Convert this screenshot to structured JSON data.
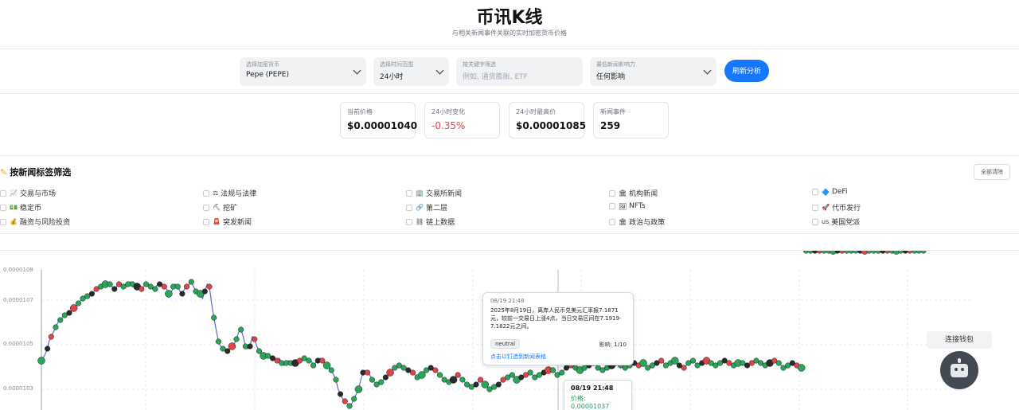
{
  "header": {
    "title": "币讯K线",
    "subtitle": "与相关新闻事件关联的实时加密货币价格"
  },
  "controls": {
    "crypto": {
      "label": "选择加密货币",
      "value": "Pepe (PEPE)"
    },
    "range": {
      "label": "选择时间范围",
      "value": "24小时"
    },
    "keyword": {
      "label": "按关键字筛选",
      "placeholder": "例如, 通货膨胀, ETF"
    },
    "impact": {
      "label": "最低新闻影响力",
      "value": "任何影响"
    },
    "refresh_label": "刷新分析"
  },
  "stats": [
    {
      "label": "当前价格",
      "value": "$0.00001040"
    },
    {
      "label": "24小时变化",
      "value": "-0.35%"
    },
    {
      "label": "24小时最高价",
      "value": "$0.00001085"
    },
    {
      "label": "新闻事件",
      "value": "259"
    }
  ],
  "filters": {
    "title": "按新闻标签筛选",
    "clear_label": "全部清除",
    "tags": [
      {
        "icon": "📈",
        "label": "交易与市场"
      },
      {
        "icon": "⚖",
        "label": "法规与法律"
      },
      {
        "icon": "🏢",
        "label": "交易所新闻"
      },
      {
        "icon": "🏛",
        "label": "机构新闻"
      },
      {
        "icon": "🔷",
        "label": "DeFi"
      },
      {
        "icon": "💵",
        "label": "稳定币"
      },
      {
        "icon": "⛏",
        "label": "挖矿"
      },
      {
        "icon": "🔗",
        "label": "第二层"
      },
      {
        "icon": "🖼",
        "label": "NFTs"
      },
      {
        "icon": "🚀",
        "label": "代币发行"
      },
      {
        "icon": "💰",
        "label": "融资与风险投资"
      },
      {
        "icon": "🚨",
        "label": "突发新闻"
      },
      {
        "icon": "⛓",
        "label": "链上数据"
      },
      {
        "icon": "🏛",
        "label": "政治与政策"
      },
      {
        "icon": "us",
        "label": "美国党派"
      }
    ]
  },
  "chart": {
    "y_ticks": [
      "0.0000108",
      "0.0000107",
      "0.0000105",
      "0.0000103"
    ],
    "colors": {
      "line": "#5b6bc9",
      "positive": "#2aa55a",
      "negative": "#e04545",
      "neutral": "#2b2b2b"
    }
  },
  "tooltip": {
    "time": "08/19 21:48",
    "body": "2025年8月19日，离岸人民币兑美元汇率报7.1871元，较前一交易日上涨4点，当日交易区间在7.1919-7.1822元之间。",
    "sentiment": "neutral",
    "impact": "影响: 1/10",
    "link": "点击以钉选到新闻表格"
  },
  "price_tip": {
    "time": "08/19 21:48",
    "price": "价格: 0.00001037"
  },
  "wallet_label": "连接钱包",
  "chart_data": {
    "type": "line",
    "ylim": [
      1.022e-05,
      1.081e-05
    ],
    "x": [
      0,
      4,
      8,
      10,
      13,
      16,
      19,
      22,
      25,
      28,
      31,
      34,
      37,
      40,
      43,
      46,
      49,
      52,
      55,
      58,
      61,
      64,
      67,
      70,
      73,
      76,
      79,
      82,
      85,
      88,
      91,
      94,
      97,
      100,
      103,
      106,
      109,
      112,
      115,
      118,
      121,
      124,
      127,
      130,
      133,
      136,
      139,
      142,
      145,
      148,
      151,
      154,
      157,
      160,
      163,
      166,
      169,
      172,
      175,
      178,
      181,
      184,
      187,
      190,
      193,
      196,
      199,
      202,
      205,
      208,
      211,
      214,
      217,
      220,
      223,
      226,
      229,
      232,
      235,
      238,
      241,
      244,
      247,
      250,
      253,
      256,
      259,
      262,
      265,
      268,
      271,
      274,
      277,
      280,
      283,
      286,
      289,
      292,
      295,
      298,
      301,
      304,
      307,
      310,
      313,
      316,
      319,
      322,
      325,
      328,
      331,
      334,
      337,
      340,
      343,
      346,
      349,
      352,
      355,
      358,
      361,
      364,
      367,
      370,
      373,
      376,
      379,
      382,
      385,
      388,
      391,
      394,
      397,
      400,
      403,
      406,
      409,
      412,
      415,
      418,
      421,
      424,
      427,
      430,
      433,
      436,
      439,
      442,
      445,
      448,
      451,
      454,
      457,
      460,
      463,
      466,
      469,
      472,
      475,
      478,
      481,
      484,
      487,
      490,
      493,
      496,
      499,
      502,
      505,
      508,
      511,
      514,
      517,
      520,
      523,
      526,
      529,
      532,
      535,
      538,
      541,
      544,
      547,
      550,
      553,
      556,
      559,
      562,
      565,
      568,
      571,
      574,
      577,
      580,
      583,
      586,
      589,
      592,
      595,
      598,
      601,
      604,
      607,
      610,
      613,
      616,
      619,
      622,
      625,
      628,
      631,
      634,
      637,
      640,
      643,
      646,
      649,
      652,
      655,
      658,
      661,
      664,
      667,
      670,
      673,
      676,
      679,
      682,
      685,
      688,
      691,
      694,
      697,
      700,
      703,
      706,
      709,
      712,
      715,
      718,
      721,
      724,
      727,
      730,
      733,
      736,
      739,
      742,
      745,
      748,
      751,
      754,
      757,
      760,
      763,
      766,
      769,
      772,
      775,
      778,
      781,
      784,
      787,
      790,
      793,
      796,
      799,
      802,
      805,
      808,
      811,
      814,
      817,
      820,
      823,
      826,
      829,
      832,
      835,
      838,
      841,
      844,
      847,
      850,
      853,
      856,
      859,
      862,
      865,
      868,
      871,
      874,
      877,
      880,
      883,
      886,
      889,
      892,
      895,
      898,
      901,
      904,
      907,
      910,
      913,
      916,
      919,
      922,
      925,
      928,
      931,
      934,
      937,
      940,
      943,
      946,
      949,
      952,
      955,
      958,
      961,
      964,
      967,
      970,
      973,
      976,
      979,
      982,
      985,
      988,
      991,
      994,
      997,
      1000,
      1003,
      1006,
      1009,
      1012,
      1015,
      1018,
      1021,
      1024,
      1027,
      1030,
      1033,
      1036,
      1039,
      1042,
      1045,
      1048,
      1051,
      1054,
      1057,
      1060,
      1063,
      1066,
      1069,
      1072,
      1075,
      1078,
      1081,
      1084,
      1087,
      1090,
      1093,
      1096,
      1099,
      1102,
      1105,
      1108,
      1111,
      1114,
      1117,
      1120,
      1123,
      1126,
      1129,
      1132,
      1135,
      1138,
      1141,
      1144,
      1147,
      1150,
      1153,
      1156,
      1159,
      1162,
      1165,
      1168,
      1171
    ],
    "series_y": [
      1.043e-05,
      1.045e-05,
      1.048e-05,
      1.051e-05,
      1.053e-05,
      1.055e-05,
      1.057e-05,
      1.059e-05,
      1.06e-05,
      1.061e-05,
      1.062e-05,
      1.062e-05,
      1.063e-05,
      1.064e-05,
      1.065e-05,
      1.066e-05,
      1.067e-05,
      1.068e-05,
      1.069e-05,
      1.07e-05,
      1.07e-05,
      1.071e-05,
      1.071e-05,
      1.072e-05,
      1.073e-05,
      1.073e-05,
      1.074e-05,
      1.074e-05,
      1.075e-05,
      1.075e-05,
      1.075e-05,
      1.074e-05,
      1.073e-05,
      1.074e-05,
      1.075e-05,
      1.075e-05,
      1.074e-05,
      1.074e-05,
      1.075e-05,
      1.076e-05,
      1.075e-05,
      1.074e-05,
      1.074e-05,
      1.073e-05,
      1.073e-05,
      1.074e-05,
      1.075e-05,
      1.075e-05,
      1.074e-05,
      1.073e-05,
      1.073e-05,
      1.075e-05,
      1.075e-05,
      1.075e-05,
      1.074e-05,
      1.073e-05,
      1.071e-05,
      1.071e-05,
      1.074e-05,
      1.075e-05,
      1.074e-05,
      1.072e-05,
      1.071e-05,
      1.073e-05,
      1.074e-05,
      1.075e-05,
      1.076e-05,
      1.074e-05,
      1.072e-05,
      1.072e-05,
      1.071e-05,
      1.069e-05,
      1.072e-05,
      1.075e-05,
      1.074e-05,
      1.067e-05,
      1.061e-05,
      1.056e-05,
      1.051e-05,
      1.049e-05,
      1.048e-05,
      1.048e-05,
      1.047e-05,
      1.048e-05,
      1.049e-05,
      1.05e-05,
      1.052e-05,
      1.055e-05,
      1.056e-05,
      1.053e-05,
      1.049e-05,
      1.048e-05,
      1.049e-05,
      1.053e-05,
      1.052e-05,
      1.049e-05,
      1.047e-05,
      1.046e-05,
      1.045e-05,
      1.045e-05,
      1.045e-05,
      1.044e-05,
      1.044e-05,
      1.043e-05,
      1.043e-05,
      1.044e-05,
      1.042e-05,
      1.041e-05,
      1.042e-05,
      1.043e-05,
      1.042e-05,
      1.041e-05,
      1.042e-05,
      1.043e-05,
      1.043e-05,
      1.043e-05,
      1.044e-05,
      1.044e-05,
      1.043e-05,
      1.043e-05,
      1.041e-05,
      1.042e-05,
      1.043e-05,
      1.044e-05,
      1.043e-05,
      1.042e-05,
      1.041e-05,
      1.04e-05,
      1.039e-05,
      1.037e-05,
      1.035e-05,
      1.031e-05,
      1.029e-05,
      1.027e-05,
      1.026e-05,
      1.025e-05,
      1.024e-05,
      1.025e-05,
      1.027e-05,
      1.029e-05,
      1.031e-05,
      1.035e-05,
      1.038e-05,
      1.039e-05,
      1.038e-05,
      1.037e-05,
      1.035e-05,
      1.034e-05,
      1.033e-05,
      1.033e-05,
      1.034e-05,
      1.035e-05,
      1.036e-05,
      1.037e-05,
      1.038e-05,
      1.039e-05,
      1.04e-05,
      1.04e-05,
      1.041e-05,
      1.041e-05,
      1.04e-05,
      1.04e-05,
      1.039e-05,
      1.038e-05,
      1.038e-05,
      1.037e-05,
      1.036e-05,
      1.036e-05,
      1.037e-05,
      1.038e-05,
      1.039e-05,
      1.039e-05,
      1.04e-05,
      1.04e-05,
      1.039e-05,
      1.038e-05,
      1.037e-05,
      1.036e-05,
      1.035e-05,
      1.035e-05,
      1.034e-05,
      1.034e-05,
      1.035e-05,
      1.036e-05,
      1.037e-05,
      1.036e-05,
      1.035e-05,
      1.034e-05,
      1.033e-05,
      1.033e-05,
      1.032e-05,
      1.032e-05,
      1.033e-05,
      1.034e-05,
      1.035e-05,
      1.034e-05,
      1.033e-05,
      1.032e-05,
      1.031e-05,
      1.031e-05,
      1.032e-05,
      1.033e-05,
      1.033e-05,
      1.034e-05,
      1.035e-05,
      1.035e-05,
      1.036e-05,
      1.037e-05,
      1.037e-05,
      1.036e-05,
      1.035e-05,
      1.035e-05,
      1.036e-05,
      1.036e-05,
      1.037e-05,
      1.038e-05,
      1.038e-05,
      1.037e-05,
      1.036e-05,
      1.036e-05,
      1.037e-05,
      1.038e-05,
      1.038e-05,
      1.039e-05,
      1.039e-05,
      1.04e-05,
      1.039e-05,
      1.038e-05,
      1.037e-05,
      1.037e-05,
      1.038e-05,
      1.039e-05,
      1.04e-05,
      1.04e-05,
      1.041e-05,
      1.041e-05,
      1.04e-05,
      1.039e-05,
      1.039e-05,
      1.039e-05,
      1.04e-05,
      1.04e-05,
      1.041e-05,
      1.041e-05,
      1.042e-05,
      1.041e-05,
      1.04e-05,
      1.04e-05,
      1.039e-05,
      1.039e-05,
      1.04e-05,
      1.041e-05,
      1.041e-05,
      1.042e-05,
      1.042e-05,
      1.041e-05,
      1.041e-05,
      1.04e-05,
      1.04e-05,
      1.041e-05,
      1.041e-05,
      1.042e-05,
      1.042e-05,
      1.041e-05,
      1.041e-05,
      1.042e-05,
      1.042e-05,
      1.041e-05,
      1.04e-05,
      1.04e-05,
      1.041e-05,
      1.041e-05,
      1.042e-05,
      1.042e-05,
      1.043e-05,
      1.042e-05,
      1.041e-05,
      1.041e-05,
      1.042e-05,
      1.042e-05,
      1.043e-05,
      1.042e-05,
      1.041e-05,
      1.04e-05,
      1.04e-05,
      1.041e-05,
      1.042e-05,
      1.042e-05,
      1.043e-05,
      1.042e-05,
      1.041e-05,
      1.041e-05,
      1.042e-05,
      1.042e-05,
      1.043e-05,
      1.043e-05,
      1.042e-05,
      1.041e-05,
      1.041e-05,
      1.042e-05,
      1.042e-05,
      1.043e-05,
      1.043e-05,
      1.042e-05,
      1.042e-05,
      1.041e-05,
      1.041e-05,
      1.042e-05,
      1.042e-05,
      1.043e-05,
      1.042e-05,
      1.042e-05,
      1.041e-05,
      1.041e-05,
      1.042e-05,
      1.042e-05,
      1.043e-05,
      1.043e-05,
      1.042e-05,
      1.041e-05,
      1.041e-05,
      1.042e-05,
      1.042e-05,
      1.043e-05,
      1.043e-05,
      1.042e-05,
      1.042e-05,
      1.041e-05,
      1.04e-05,
      1.04e-05,
      1.041e-05,
      1.041e-05,
      1.042e-05,
      1.042e-05,
      1.041e-05,
      1.041e-05,
      1.04e-05,
      1.04e-05
    ]
  }
}
